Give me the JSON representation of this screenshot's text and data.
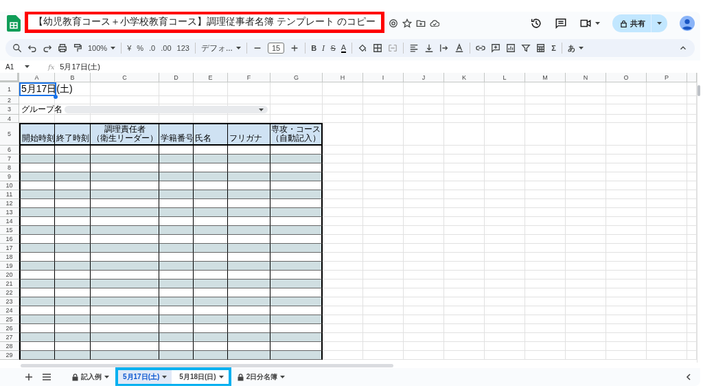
{
  "title": "【幼児教育コース＋小学校教育コース】調理従事者名簿 テンプレート のコピー",
  "share_button": {
    "label": "共有"
  },
  "toolbar": {
    "zoom": "100%",
    "currency": "¥",
    "percent": "%",
    "decimal_decrease": ".0",
    "decimal_increase": ".00",
    "number_format": "123",
    "font": "デフォ...",
    "font_size": "15",
    "bold": "B",
    "italic": "I",
    "strikethrough": "S",
    "text_color": "A",
    "sum": "Σ",
    "input_tool": "あ"
  },
  "formula_bar": {
    "cell_ref": "A1",
    "fx": "fx",
    "value": "5月17日(土)"
  },
  "columns": [
    "A",
    "B",
    "C",
    "D",
    "E",
    "F",
    "G",
    "H",
    "I",
    "J",
    "K",
    "L",
    "M",
    "N",
    "O",
    "P"
  ],
  "sheet": {
    "top_rows": [
      "1",
      "2",
      "3",
      "4",
      "5"
    ],
    "date": "5月17日(土)",
    "group_label": "グループ名",
    "headers": [
      [
        "開始時刻"
      ],
      [
        "終了時刻"
      ],
      [
        "調理責任者",
        "（衛生リーダー）"
      ],
      [
        "学籍番号"
      ],
      [
        "氏名"
      ],
      [
        "フリガナ"
      ],
      [
        "専攻・コース",
        "（自動記入）"
      ]
    ],
    "rows": [
      {
        "number": "6",
        "shaded": false
      },
      {
        "number": "7",
        "shaded": true
      },
      {
        "number": "8",
        "shaded": false
      },
      {
        "number": "9",
        "shaded": true
      },
      {
        "number": "10",
        "shaded": false
      },
      {
        "number": "11",
        "shaded": true
      },
      {
        "number": "12",
        "shaded": false
      },
      {
        "number": "13",
        "shaded": true
      },
      {
        "number": "14",
        "shaded": false
      },
      {
        "number": "15",
        "shaded": true
      },
      {
        "number": "16",
        "shaded": false
      },
      {
        "number": "17",
        "shaded": true
      },
      {
        "number": "18",
        "shaded": false
      },
      {
        "number": "19",
        "shaded": true
      },
      {
        "number": "20",
        "shaded": false
      },
      {
        "number": "21",
        "shaded": true
      },
      {
        "number": "22",
        "shaded": false
      },
      {
        "number": "23",
        "shaded": true
      },
      {
        "number": "24",
        "shaded": false
      },
      {
        "number": "25",
        "shaded": true
      },
      {
        "number": "26",
        "shaded": false
      },
      {
        "number": "27",
        "shaded": true
      },
      {
        "number": "28",
        "shaded": false
      },
      {
        "number": "29",
        "shaded": true
      }
    ]
  },
  "sheet_tabs": [
    {
      "label": "記入例",
      "locked": true,
      "selected": false
    },
    {
      "label": "5月17日(土)",
      "locked": false,
      "selected": true
    },
    {
      "label": "5月18日(日)",
      "locked": false,
      "selected": false
    },
    {
      "label": "2日分名簿",
      "locked": true,
      "selected": false
    }
  ],
  "highlights": [
    {
      "color": "#ff0000"
    },
    {
      "color": "#00b0f0"
    }
  ]
}
